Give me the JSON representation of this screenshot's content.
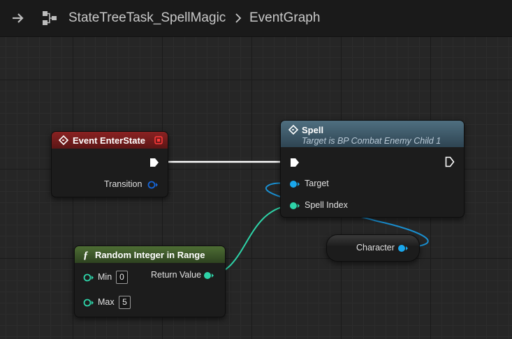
{
  "breadcrumb": {
    "asset": "StateTreeTask_SpellMagic",
    "graph": "EventGraph"
  },
  "nodes": {
    "event_enter_state": {
      "title": "Event EnterState",
      "header_color": "#7a1e1e",
      "pins": {
        "transition": "Transition"
      }
    },
    "spell": {
      "title": "Spell",
      "subtitle": "Target is BP Combat Enemy Child 1",
      "header_color": "#3d5a6b",
      "pins": {
        "target": "Target",
        "spell_index": "Spell Index"
      }
    },
    "character": {
      "label": "Character"
    },
    "random_integer": {
      "title": "Random Integer in Range",
      "header_color": "#3d5a2c",
      "pins": {
        "min": "Min",
        "min_value": "0",
        "max": "Max",
        "max_value": "5",
        "return_value": "Return Value"
      }
    }
  },
  "colors": {
    "exec_wire": "#ffffff",
    "object_pin": "#1aa7ec",
    "integer_pin": "#2ed3a8",
    "struct_pin": "#1565d8"
  }
}
